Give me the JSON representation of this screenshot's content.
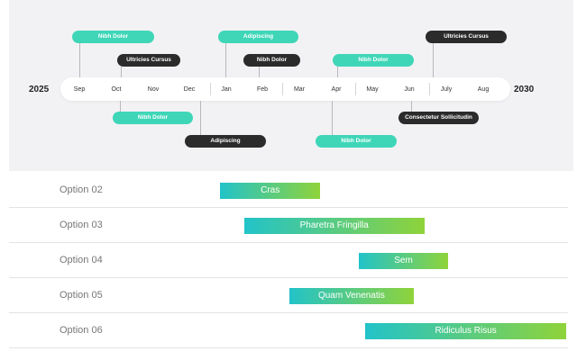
{
  "timeline": {
    "year_start": "2025",
    "year_end": "2030",
    "months": [
      "Sep",
      "Oct",
      "Nov",
      "Dec",
      "Jan",
      "Feb",
      "Mar",
      "Apr",
      "May",
      "Jun",
      "July",
      "Aug"
    ],
    "events_above": [
      {
        "label": "Nibh Dolor",
        "style": "teal"
      },
      {
        "label": "Ultricies Cursus",
        "style": "dark"
      },
      {
        "label": "Adipiscing",
        "style": "teal"
      },
      {
        "label": "Nibh Dolor",
        "style": "dark"
      },
      {
        "label": "Nibh Dolor",
        "style": "teal"
      },
      {
        "label": "Ultricies Cursus",
        "style": "dark"
      }
    ],
    "events_below": [
      {
        "label": "Nibh Dolor",
        "style": "teal"
      },
      {
        "label": "Adipiscing",
        "style": "dark"
      },
      {
        "label": "Nibh Dolor",
        "style": "teal"
      },
      {
        "label": "Consectetur Sollicitudin",
        "style": "dark"
      }
    ]
  },
  "gantt": {
    "rows": [
      {
        "label": "Option 02",
        "task": "Cras",
        "start": 0.0,
        "end": 0.29
      },
      {
        "label": "Option 03",
        "task": "Pharetra Fringilla",
        "start": 0.07,
        "end": 0.59
      },
      {
        "label": "Option 04",
        "task": "Sem",
        "start": 0.4,
        "end": 0.66
      },
      {
        "label": "Option 05",
        "task": "Quam Venenatis",
        "start": 0.2,
        "end": 0.56
      },
      {
        "label": "Option 06",
        "task": "Ridiculus Risus",
        "start": 0.42,
        "end": 1.0
      }
    ]
  }
}
